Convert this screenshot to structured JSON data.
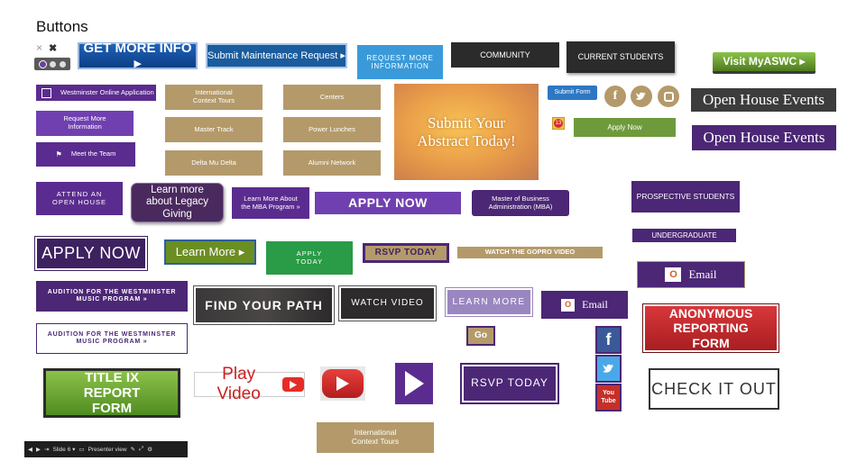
{
  "page": {
    "title": "Buttons"
  },
  "mini_widget": {
    "close_x": "×"
  },
  "buttons": {
    "get_more_info": "GET MORE INFO ▸",
    "submit_maintenance": "Submit Maintenance Request ▸",
    "request_more_info_blue": "REQUEST MORE INFORMATION",
    "community": "COMMUNITY",
    "current_students": "CURRENT STUDENTS",
    "visit_myaswc": "Visit MyASWC ▸",
    "westminster_online": "Westminster Online Application",
    "request_more_info_purple": "Request More Information",
    "meet_team": "Meet the Team",
    "intl_context_tours": "International Context Tours",
    "centers": "Centers",
    "master_track": "Master Track",
    "power_lunches": "Power Lunches",
    "delta_mu_delta": "Delta Mu Delta",
    "alumni_network": "Alumni Network",
    "abstract_line1": "Submit Your",
    "abstract_line2": "Abstract Today!",
    "submit_form": "Submit Form",
    "apply_now_green": "Apply Now",
    "open_house_events_1": "Open House Events",
    "open_house_events_2": "Open House Events",
    "attend_open_house": "ATTEND AN OPEN HOUSE",
    "legacy_giving": "Learn more about Legacy Giving",
    "mba_program": "Learn More About the MBA Program »",
    "apply_now_purple": "APPLY NOW",
    "master_business": "Master of Business Administration (MBA)",
    "prospective_students": "PROSPECTIVE STUDENTS",
    "undergraduate": "UNDERGRADUATE",
    "apply_now_outline": "APPLY NOW",
    "learn_more_olive": "Learn More ▸",
    "apply_today": "APPLY TODAY",
    "rsvp_today_gold": "RSVP TODAY",
    "watch_gopro": "WATCH THE GOPRO VIDEO",
    "email_1": "Email",
    "audition_purple": "AUDITION FOR THE WESTMINSTER MUSIC PROGRAM »",
    "find_your_path": "FIND YOUR PATH",
    "watch_video": "WATCH VIDEO",
    "learn_more_lav": "LEARN MORE",
    "email_2": "Email",
    "anonymous_reporting": "ANONYMOUS REPORTING FORM",
    "audition_white": "AUDITION FOR THE WESTMINSTER MUSIC PROGRAM »",
    "go": "Go",
    "title_ix": "TITLE IX REPORT FORM",
    "play_video": "Play Video",
    "rsvp_today_purple": "RSVP TODAY",
    "check_it_out": "CHECK IT OUT",
    "intl_context_tours_2": "International Context Tours"
  },
  "social": {
    "facebook": "f",
    "youtube": "You Tube",
    "badge": "13"
  },
  "slideshow_bar": {
    "slide_label": "Slide 6 ▾",
    "presenter_view": "Presenter view"
  }
}
